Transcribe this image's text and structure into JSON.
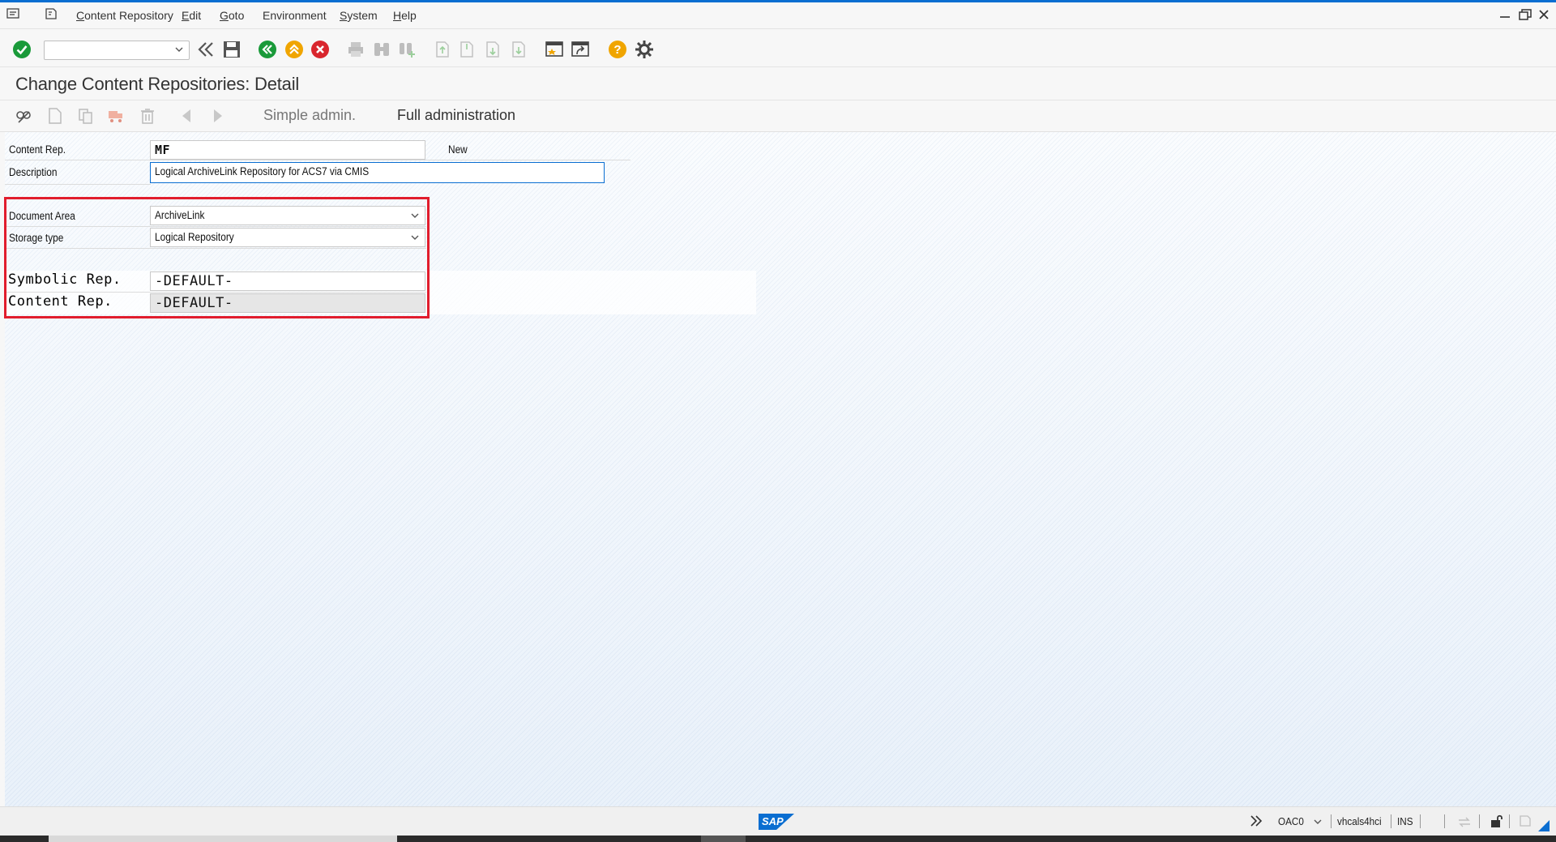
{
  "menu": {
    "items": [
      {
        "label": "Content Repository",
        "underline": "C",
        "rest": "ontent Repository"
      },
      {
        "label": "Edit",
        "underline": "E",
        "rest": "dit"
      },
      {
        "label": "Goto",
        "underline": "G",
        "rest": "oto"
      },
      {
        "label": "Environment",
        "underline": "",
        "rest": "Environment"
      },
      {
        "label": "System",
        "underline": "S",
        "rest": "ystem"
      },
      {
        "label": "Help",
        "underline": "H",
        "rest": "elp"
      }
    ]
  },
  "title": "Change Content Repositories: Detail",
  "app_toolbar": {
    "simple_admin": "Simple admin.",
    "full_admin": "Full administration"
  },
  "form": {
    "content_rep_label": "Content Rep.",
    "content_rep_value": "MF",
    "status": "New",
    "description_label": "Description",
    "description_value": "Logical ArchiveLink Repository for ACS7 via CMIS",
    "document_area_label": "Document Area",
    "document_area_value": "ArchiveLink",
    "storage_type_label": "Storage type",
    "storage_type_value": "Logical Repository",
    "symbolic_rep_label": "Symbolic Rep.",
    "symbolic_rep_value": "-DEFAULT-",
    "content_rep2_label": "Content Rep.",
    "content_rep2_value": "-DEFAULT-"
  },
  "status_bar": {
    "transaction": "OAC0",
    "server": "vhcals4hci",
    "mode": "INS"
  },
  "colors": {
    "highlight": "#e11d2d",
    "ok_green": "#1a9a3a",
    "cancel_red": "#d9262e",
    "exit_orange": "#f0a500",
    "sap_blue": "#0a6ed1"
  }
}
